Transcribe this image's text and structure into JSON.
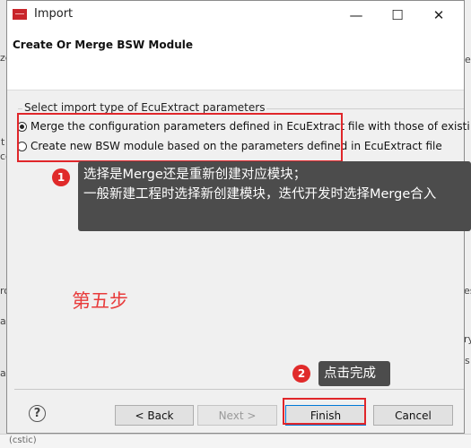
{
  "background": {
    "left_chars": [
      "ze",
      "t",
      "co",
      "ro",
      "as",
      "as"
    ],
    "right_chars": [
      "e",
      "es",
      "ry",
      "s"
    ],
    "bottom_text": "(cstic)"
  },
  "dialog": {
    "title": "Import",
    "window_controls": {
      "minimize": "—",
      "maximize": "☐",
      "close": "✕"
    },
    "header_title": "Create Or Merge BSW Module",
    "group_label": "Select import type of EcuExtract parameters",
    "options": [
      {
        "label": "Merge the configuration parameters defined in EcuExtract file with those of existi",
        "checked": true
      },
      {
        "label": "Create new BSW module based on the parameters defined in EcuExtract file",
        "checked": false
      }
    ],
    "buttons": {
      "back": "< Back",
      "next": "Next >",
      "finish": "Finish",
      "cancel": "Cancel"
    },
    "help_glyph": "?"
  },
  "annotations": {
    "marker1": "1",
    "tooltip1_line1": "选择是Merge还是重新创建对应模块；",
    "tooltip1_line2": "一般新建工程时选择新创建模块，迭代开发时选择Merge合入",
    "step_text": "第五步",
    "marker2": "2",
    "tooltip2": "点击完成"
  },
  "colors": {
    "annotation_red": "#e0262a",
    "tooltip_bg": "#4c4c4c",
    "primary_border": "#0078d7"
  }
}
